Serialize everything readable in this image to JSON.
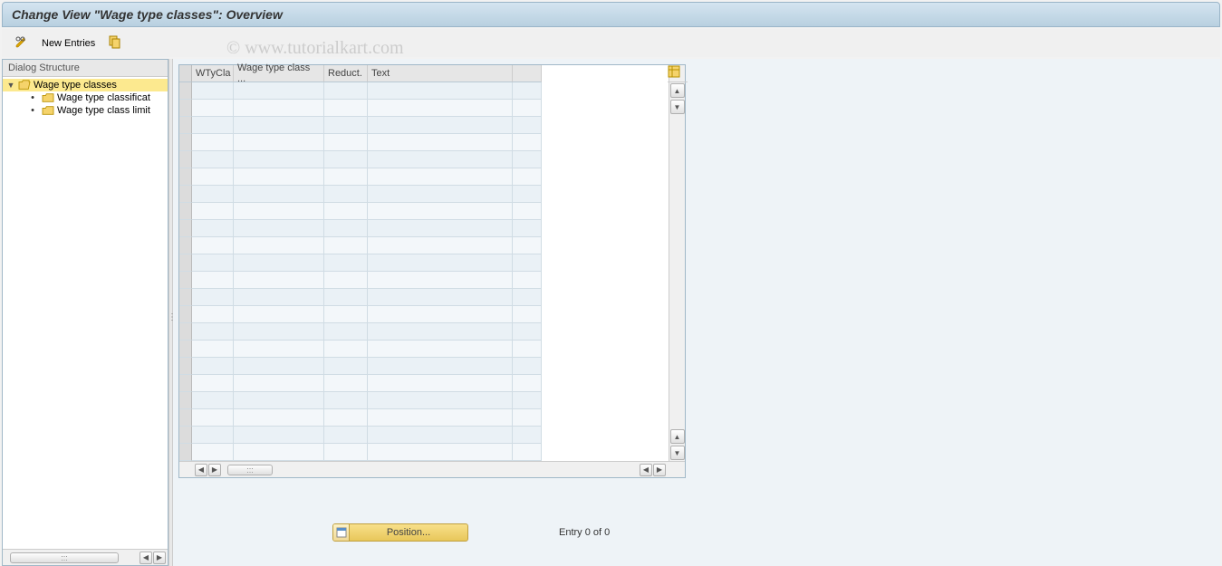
{
  "title": "Change View \"Wage type classes\": Overview",
  "toolbar": {
    "new_entries_label": "New Entries"
  },
  "dialog_structure": {
    "header": "Dialog Structure",
    "items": [
      {
        "label": "Wage type classes",
        "selected": true,
        "level": 0,
        "expanded": true,
        "folder": "open"
      },
      {
        "label": "Wage type classificat",
        "selected": false,
        "level": 1,
        "folder": "closed"
      },
      {
        "label": "Wage type class limit",
        "selected": false,
        "level": 1,
        "folder": "closed"
      }
    ]
  },
  "grid": {
    "columns": [
      "WTyCla",
      "Wage type class ...",
      "Reduct.",
      "Text"
    ],
    "row_count": 22
  },
  "footer": {
    "position_button": "Position...",
    "entry_text": "Entry 0 of 0"
  },
  "watermark": "© www.tutorialkart.com"
}
